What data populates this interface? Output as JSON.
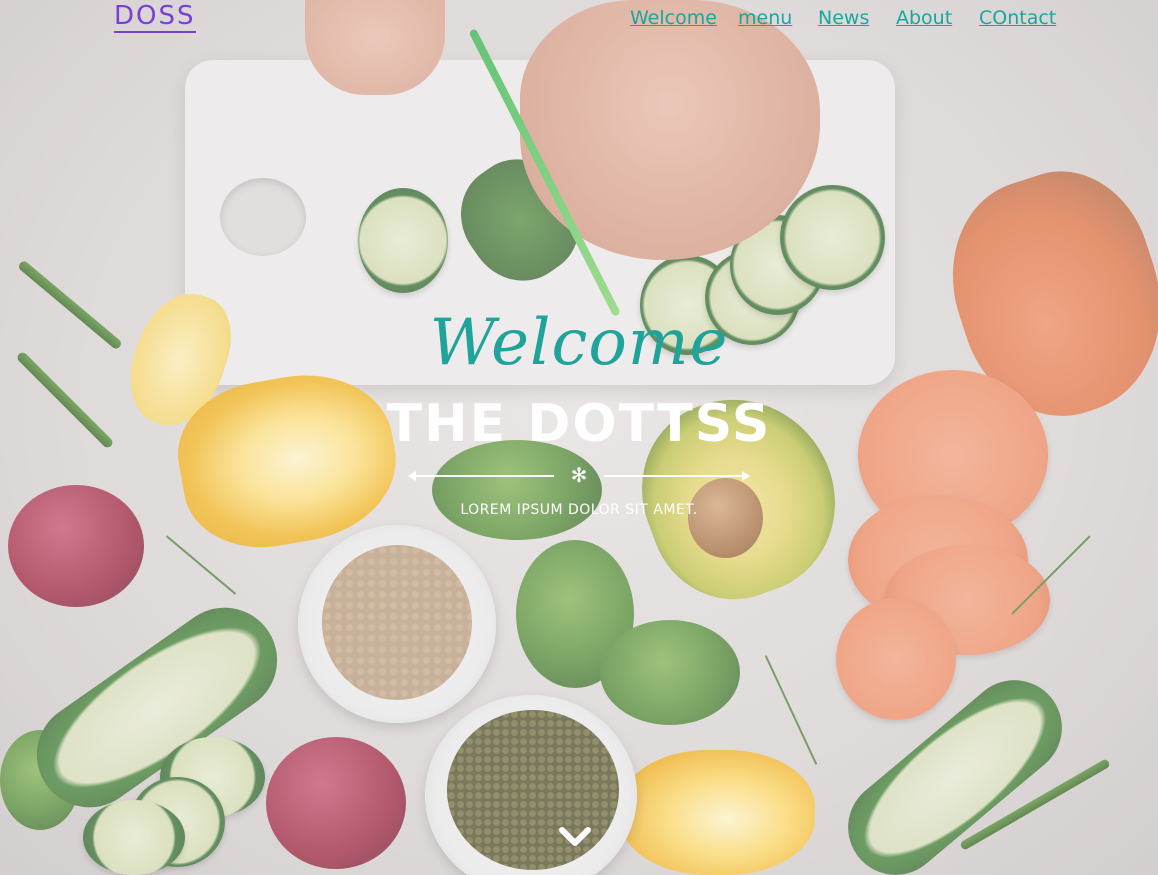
{
  "brand": {
    "label": "DOSS",
    "color": "#7b3fd6"
  },
  "nav": {
    "color": "#17a7a0",
    "items": [
      {
        "label": "Welcome"
      },
      {
        "label": "menu"
      },
      {
        "label": "News"
      },
      {
        "label": "About"
      },
      {
        "label": "COntact"
      }
    ]
  },
  "hero": {
    "script_title": "Welcome",
    "title": "THE DOTTSS",
    "divider_icon": "snowflake-icon",
    "subtitle": "LOREM IPSUM DOLOR SIT AMET.",
    "scroll_icon": "chevron-down-icon"
  }
}
